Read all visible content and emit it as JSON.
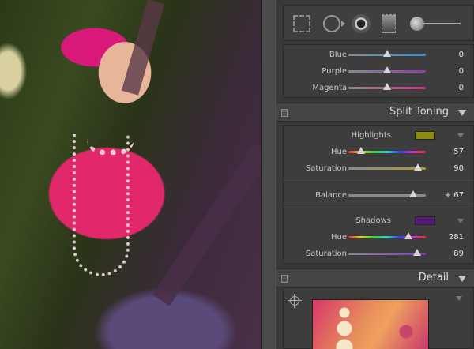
{
  "hsl_sliders": [
    {
      "label": "Blue",
      "value": "0",
      "position": 0.5
    },
    {
      "label": "Purple",
      "value": "0",
      "position": 0.5
    },
    {
      "label": "Magenta",
      "value": "0",
      "position": 0.5
    }
  ],
  "split_toning": {
    "title": "Split Toning",
    "highlights": {
      "label": "Highlights",
      "swatch_color": "#8c8a14",
      "hue": {
        "label": "Hue",
        "value": "57",
        "position": 0.16
      },
      "saturation": {
        "label": "Saturation",
        "value": "90",
        "position": 0.9
      }
    },
    "balance": {
      "label": "Balance",
      "value": "+ 67",
      "position": 0.835
    },
    "shadows": {
      "label": "Shadows",
      "swatch_color": "#5a1a7a",
      "hue": {
        "label": "Hue",
        "value": "281",
        "position": 0.78
      },
      "saturation": {
        "label": "Saturation",
        "value": "89",
        "position": 0.89
      }
    }
  },
  "detail": {
    "title": "Detail"
  },
  "icons": [
    "crop-icon",
    "spot-removal-icon",
    "red-eye-icon",
    "graduated-filter-icon",
    "adjustment-brush-icon",
    "target-adjust-icon"
  ]
}
